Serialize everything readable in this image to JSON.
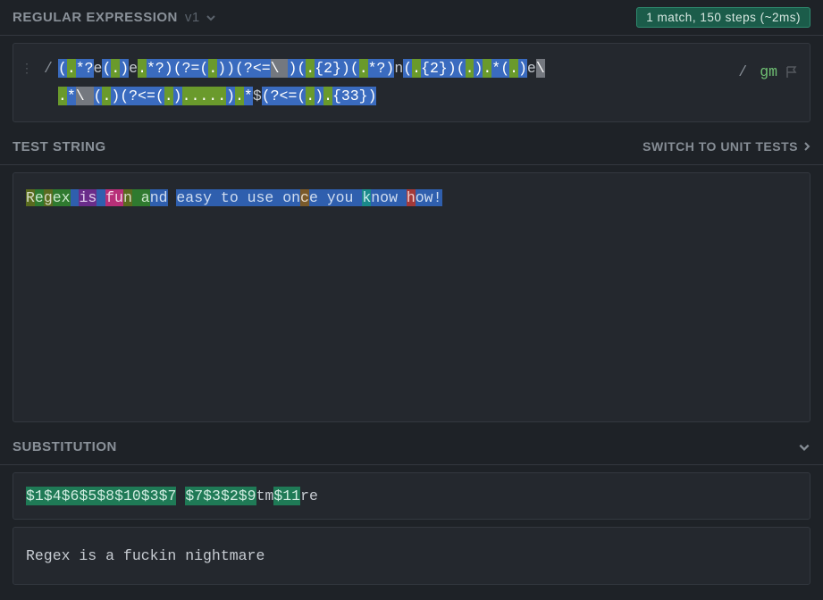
{
  "header": {
    "title": "REGULAR EXPRESSION",
    "version": "v1",
    "badge": "1 match, 150 steps (~2ms)"
  },
  "regex": {
    "open_delim": "/",
    "close_delim": "/",
    "flags": "gm",
    "tokens_line1": [
      {
        "t": "grp",
        "v": "("
      },
      {
        "t": "any",
        "v": "."
      },
      {
        "t": "quant",
        "v": "*?"
      },
      {
        "t": "lit",
        "v": "e"
      },
      {
        "t": "grp",
        "v": "("
      },
      {
        "t": "any",
        "v": "."
      },
      {
        "t": "grp",
        "v": ")"
      },
      {
        "t": "lit",
        "v": "e"
      },
      {
        "t": "any",
        "v": "."
      },
      {
        "t": "quant",
        "v": "*?"
      },
      {
        "t": "grp",
        "v": ")"
      },
      {
        "t": "grp",
        "v": "(?="
      },
      {
        "t": "grp",
        "v": "("
      },
      {
        "t": "any",
        "v": "."
      },
      {
        "t": "grp",
        "v": ")"
      },
      {
        "t": "grp",
        "v": ")"
      },
      {
        "t": "grp",
        "v": "(?<="
      },
      {
        "t": "esc",
        "v": "\\ "
      },
      {
        "t": "grp",
        "v": ")"
      },
      {
        "t": "grp",
        "v": "("
      },
      {
        "t": "any",
        "v": "."
      },
      {
        "t": "quant",
        "v": "{2}"
      },
      {
        "t": "grp",
        "v": ")"
      },
      {
        "t": "grp",
        "v": "("
      },
      {
        "t": "any",
        "v": "."
      },
      {
        "t": "quant",
        "v": "*?"
      },
      {
        "t": "grp",
        "v": ")"
      },
      {
        "t": "lit",
        "v": "n"
      },
      {
        "t": "grp",
        "v": "("
      },
      {
        "t": "any",
        "v": "."
      },
      {
        "t": "quant",
        "v": "{2}"
      },
      {
        "t": "grp",
        "v": ")"
      },
      {
        "t": "grp",
        "v": "("
      },
      {
        "t": "any",
        "v": "."
      },
      {
        "t": "grp",
        "v": ")"
      },
      {
        "t": "any",
        "v": "."
      },
      {
        "t": "quant",
        "v": "*"
      },
      {
        "t": "grp",
        "v": "("
      },
      {
        "t": "any",
        "v": "."
      },
      {
        "t": "grp",
        "v": ")"
      },
      {
        "t": "lit",
        "v": "e"
      },
      {
        "t": "esc",
        "v": "\\ "
      }
    ],
    "tokens_line2": [
      {
        "t": "any",
        "v": "."
      },
      {
        "t": "quant",
        "v": "*"
      },
      {
        "t": "esc",
        "v": "\\ "
      },
      {
        "t": "grp",
        "v": "("
      },
      {
        "t": "any",
        "v": "."
      },
      {
        "t": "grp",
        "v": ")"
      },
      {
        "t": "grp",
        "v": "(?<="
      },
      {
        "t": "grp",
        "v": "("
      },
      {
        "t": "any",
        "v": "."
      },
      {
        "t": "grp",
        "v": ")"
      },
      {
        "t": "any",
        "v": "."
      },
      {
        "t": "any",
        "v": "."
      },
      {
        "t": "any",
        "v": "."
      },
      {
        "t": "any",
        "v": "."
      },
      {
        "t": "any",
        "v": "."
      },
      {
        "t": "grp",
        "v": ")"
      },
      {
        "t": "any",
        "v": "."
      },
      {
        "t": "quant",
        "v": "*"
      },
      {
        "t": "lit",
        "v": "$"
      },
      {
        "t": "grp",
        "v": "(?<="
      },
      {
        "t": "grp",
        "v": "("
      },
      {
        "t": "any",
        "v": "."
      },
      {
        "t": "grp",
        "v": ")"
      },
      {
        "t": "any",
        "v": "."
      },
      {
        "t": "quant",
        "v": "{33}"
      },
      {
        "t": "grp",
        "v": ")"
      }
    ]
  },
  "test_section": {
    "title": "TEST STRING",
    "switch_label": "SWITCH TO UNIT TESTS",
    "segments": [
      {
        "c": "g-olive",
        "v": "R"
      },
      {
        "c": "g-green",
        "v": "e"
      },
      {
        "c": "g-olive",
        "v": "g"
      },
      {
        "c": "g-green",
        "v": "ex"
      },
      {
        "c": "g-blue",
        "v": " "
      },
      {
        "c": "g-purple",
        "v": "is"
      },
      {
        "c": "g-blue",
        "v": " "
      },
      {
        "c": "g-pink",
        "v": "fu"
      },
      {
        "c": "g-olive",
        "v": "n"
      },
      {
        "c": "g-green",
        "v": " a"
      },
      {
        "c": "g-blue",
        "v": "nd"
      },
      {
        "c": "plain",
        "v": " "
      },
      {
        "c": "g-blue",
        "v": "easy to use on"
      },
      {
        "c": "g-brown",
        "v": "c"
      },
      {
        "c": "g-blue",
        "v": "e you "
      },
      {
        "c": "g-teal",
        "v": "k"
      },
      {
        "c": "g-blue",
        "v": "now "
      },
      {
        "c": "g-red",
        "v": "h"
      },
      {
        "c": "g-blue",
        "v": "ow!"
      }
    ]
  },
  "substitution": {
    "title": "SUBSTITUTION",
    "segments": [
      {
        "c": "sub-grp",
        "v": "$1"
      },
      {
        "c": "sub-grp",
        "v": "$4"
      },
      {
        "c": "sub-grp",
        "v": "$6"
      },
      {
        "c": "sub-grp",
        "v": "$5"
      },
      {
        "c": "sub-grp",
        "v": "$8"
      },
      {
        "c": "sub-grp",
        "v": "$10"
      },
      {
        "c": "sub-grp",
        "v": "$3"
      },
      {
        "c": "sub-grp",
        "v": "$7"
      },
      {
        "c": "sub-lit",
        "v": " "
      },
      {
        "c": "sub-grp",
        "v": "$7"
      },
      {
        "c": "sub-grp",
        "v": "$3"
      },
      {
        "c": "sub-grp",
        "v": "$2"
      },
      {
        "c": "sub-grp",
        "v": "$9"
      },
      {
        "c": "sub-lit",
        "v": "tm"
      },
      {
        "c": "sub-grp",
        "v": "$11"
      },
      {
        "c": "sub-lit",
        "v": "re"
      }
    ],
    "result": "Regex is a fuckin nightmare"
  }
}
